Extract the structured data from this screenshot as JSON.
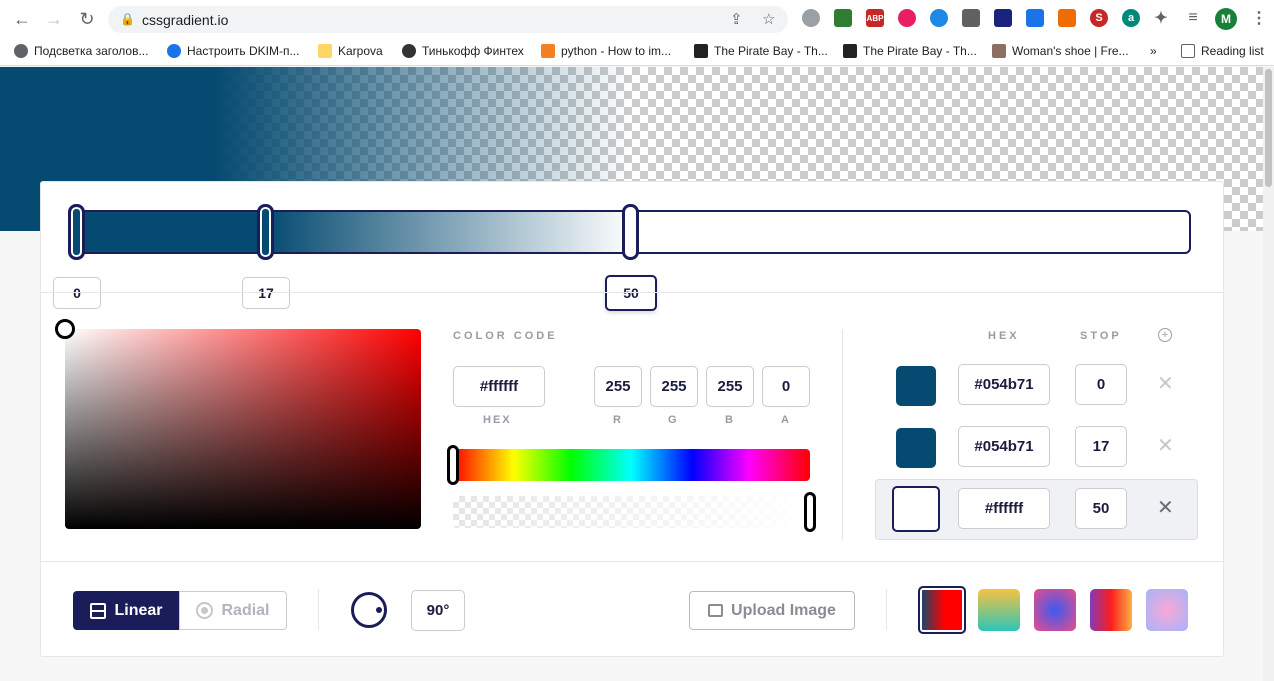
{
  "browser": {
    "url": "cssgradient.io",
    "profile_initial": "M",
    "bookmarks": [
      "Подсветка заголов...",
      "Настроить DKIM-п...",
      "Karpova",
      "Тинькофф Финтех",
      "python - How to im...",
      "The Pirate Bay - Th...",
      "The Pirate Bay - Th...",
      "Woman's shoe | Fre...",
      "»",
      "Reading list"
    ]
  },
  "gradient": {
    "handles": [
      {
        "stop": 0,
        "color": "#054b71"
      },
      {
        "stop": 17,
        "color": "#054b71"
      },
      {
        "stop": 50,
        "color": "#ffffff"
      }
    ],
    "stop_labels": [
      "0",
      "17",
      "50"
    ]
  },
  "picker": {
    "section_label": "COLOR CODE",
    "hex_value": "#ffffff",
    "hex_caption": "HEX",
    "r": "255",
    "g": "255",
    "b": "255",
    "a": "0",
    "r_caption": "R",
    "g_caption": "G",
    "b_caption": "B",
    "a_caption": "A"
  },
  "stops_table": {
    "hex_header": "HEX",
    "stop_header": "STOP",
    "add_icon": "plus-circle-icon",
    "rows": [
      {
        "hex": "#054b71",
        "stop": "0",
        "color": "#054b71"
      },
      {
        "hex": "#054b71",
        "stop": "17",
        "color": "#054b71"
      },
      {
        "hex": "#ffffff",
        "stop": "50",
        "color": "#ffffff"
      }
    ]
  },
  "toolbar": {
    "linear_label": "Linear",
    "radial_label": "Radial",
    "angle_value": "90°",
    "upload_label": "Upload Image"
  },
  "presets": [
    {
      "colors": [
        "#054b71",
        "#ff0000"
      ]
    },
    {
      "colors": [
        "#f6c343",
        "#2ec4b6"
      ]
    },
    {
      "colors": [
        "#3d5af1",
        "#e94d8a"
      ]
    },
    {
      "colors": [
        "#833ab4",
        "#fd1d1d",
        "#fcb045"
      ]
    },
    {
      "colors": [
        "#a5b4fc",
        "#f9a8d4"
      ]
    }
  ]
}
